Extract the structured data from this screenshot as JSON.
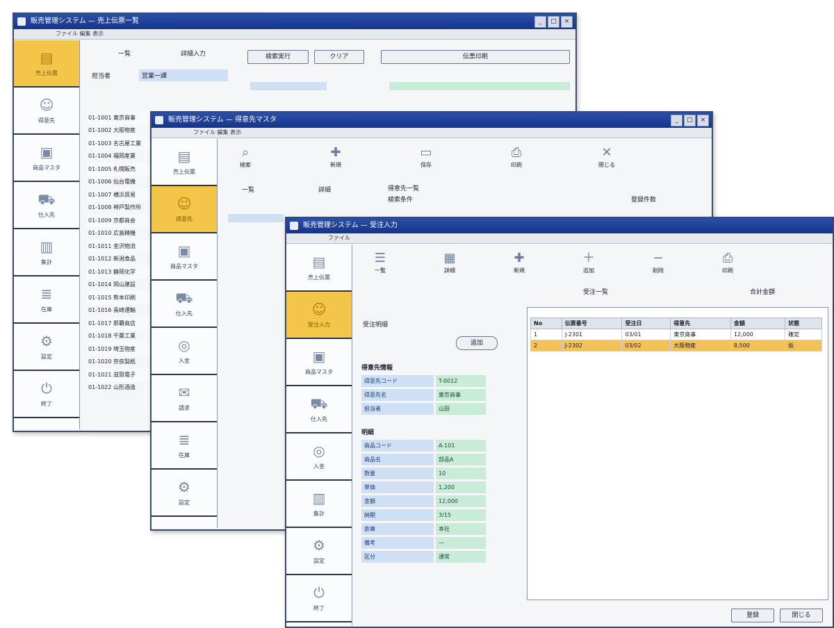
{
  "win1": {
    "title": "販売管理システム — 売上伝票一覧",
    "menu": "ファイル 編集 表示",
    "sidebar": [
      {
        "label": "売上伝票",
        "icon": "document-icon"
      },
      {
        "label": "得意先",
        "icon": "people-icon"
      },
      {
        "label": "商品マスタ",
        "icon": "box-icon"
      },
      {
        "label": "仕入先",
        "icon": "truck-icon"
      },
      {
        "label": "集計",
        "icon": "chart-icon"
      },
      {
        "label": "在庫",
        "icon": "stack-icon"
      },
      {
        "label": "設定",
        "icon": "gear-icon"
      },
      {
        "label": "終了",
        "icon": "power-icon"
      }
    ],
    "tabs": [
      "一覧",
      "詳細入力"
    ],
    "buttons": {
      "search": "検索実行",
      "clear": "クリア",
      "print": "伝票印刷"
    },
    "filter_label": "担当者",
    "filter_value": "営業一課",
    "rows": [
      "01-1001 東京商事",
      "01-1002 大阪物産",
      "01-1003 名古屋工業",
      "01-1004 福岡産業",
      "01-1005 札幌販売",
      "01-1006 仙台電機",
      "01-1007 横浜貿易",
      "01-1008 神戸製作所",
      "01-1009 京都商会",
      "01-1010 広島精機",
      "01-1011 金沢物流",
      "01-1012 新潟食品",
      "01-1013 静岡化学",
      "01-1014 岡山建設",
      "01-1015 熊本印刷",
      "01-1016 長崎運輸",
      "01-1017 那覇商店",
      "01-1018 千葉工業",
      "01-1019 埼玉物産",
      "01-1020 奈良製紙",
      "01-1021 滋賀電子",
      "01-1022 山形酒造"
    ]
  },
  "win2": {
    "title": "販売管理システム — 得意先マスタ",
    "menu": "ファイル 編集 表示",
    "tools": [
      {
        "label": "検索",
        "icon": "search-icon"
      },
      {
        "label": "新規",
        "icon": "new-icon"
      },
      {
        "label": "保存",
        "icon": "save-icon"
      },
      {
        "label": "印刷",
        "icon": "printer-icon"
      },
      {
        "label": "閉じる",
        "icon": "close-icon"
      }
    ],
    "sidebar": [
      {
        "label": "売上伝票",
        "icon": "document-icon"
      },
      {
        "label": "得意先",
        "icon": "people-icon"
      },
      {
        "label": "商品マスタ",
        "icon": "box-icon"
      },
      {
        "label": "仕入先",
        "icon": "truck-icon"
      },
      {
        "label": "入金",
        "icon": "coin-icon"
      },
      {
        "label": "請求",
        "icon": "mail-icon"
      },
      {
        "label": "在庫",
        "icon": "stack-icon"
      },
      {
        "label": "設定",
        "icon": "gear-icon"
      }
    ],
    "labels": {
      "a": "一覧",
      "b": "詳細",
      "c": "得意先一覧",
      "d": "検索条件",
      "e": "登録件数"
    }
  },
  "win3": {
    "title": "販売管理システム — 受注入力",
    "menu": "ファイル",
    "tools": [
      {
        "label": "一覧",
        "icon": "list-icon"
      },
      {
        "label": "詳細",
        "icon": "detail-icon"
      },
      {
        "label": "新規",
        "icon": "new-icon"
      },
      {
        "label": "追加",
        "icon": "add-icon"
      },
      {
        "label": "削除",
        "icon": "delete-icon"
      },
      {
        "label": "印刷",
        "icon": "printer-icon"
      }
    ],
    "sidebar": [
      {
        "label": "売上伝票",
        "icon": "document-icon"
      },
      {
        "label": "受注入力",
        "icon": "people-icon"
      },
      {
        "label": "商品マスタ",
        "icon": "box-icon"
      },
      {
        "label": "仕入先",
        "icon": "truck-icon"
      },
      {
        "label": "入金",
        "icon": "coin-icon"
      },
      {
        "label": "集計",
        "icon": "chart-icon"
      },
      {
        "label": "設定",
        "icon": "gear-icon"
      },
      {
        "label": "終了",
        "icon": "power-icon"
      }
    ],
    "section_title": "受注明細",
    "add_button": "追加",
    "section1": "得意先情報",
    "fields1": [
      {
        "k": "得意先コード",
        "v": "T-0012"
      },
      {
        "k": "得意先名",
        "v": "東京商事"
      },
      {
        "k": "担当者",
        "v": "山田"
      }
    ],
    "section2": "明細",
    "fields2": [
      {
        "k": "商品コード",
        "v": "A-101"
      },
      {
        "k": "商品名",
        "v": "部品A"
      },
      {
        "k": "数量",
        "v": "10"
      },
      {
        "k": "単価",
        "v": "1,200"
      },
      {
        "k": "金額",
        "v": "12,000"
      },
      {
        "k": "納期",
        "v": "3/15"
      },
      {
        "k": "倉庫",
        "v": "本社"
      },
      {
        "k": "備考",
        "v": "—"
      },
      {
        "k": "区分",
        "v": "通常"
      }
    ],
    "grid_headers": [
      "No",
      "伝票番号",
      "受注日",
      "得意先",
      "金額",
      "状態"
    ],
    "grid_rows": [
      [
        "1",
        "J-2301",
        "03/01",
        "東京商事",
        "12,000",
        "確定"
      ],
      [
        "2",
        "J-2302",
        "03/02",
        "大阪物産",
        "8,500",
        "仮"
      ]
    ],
    "right_labels": {
      "a": "受注一覧",
      "b": "合計金額"
    },
    "footer": {
      "ok": "登録",
      "cancel": "閉じる"
    }
  }
}
